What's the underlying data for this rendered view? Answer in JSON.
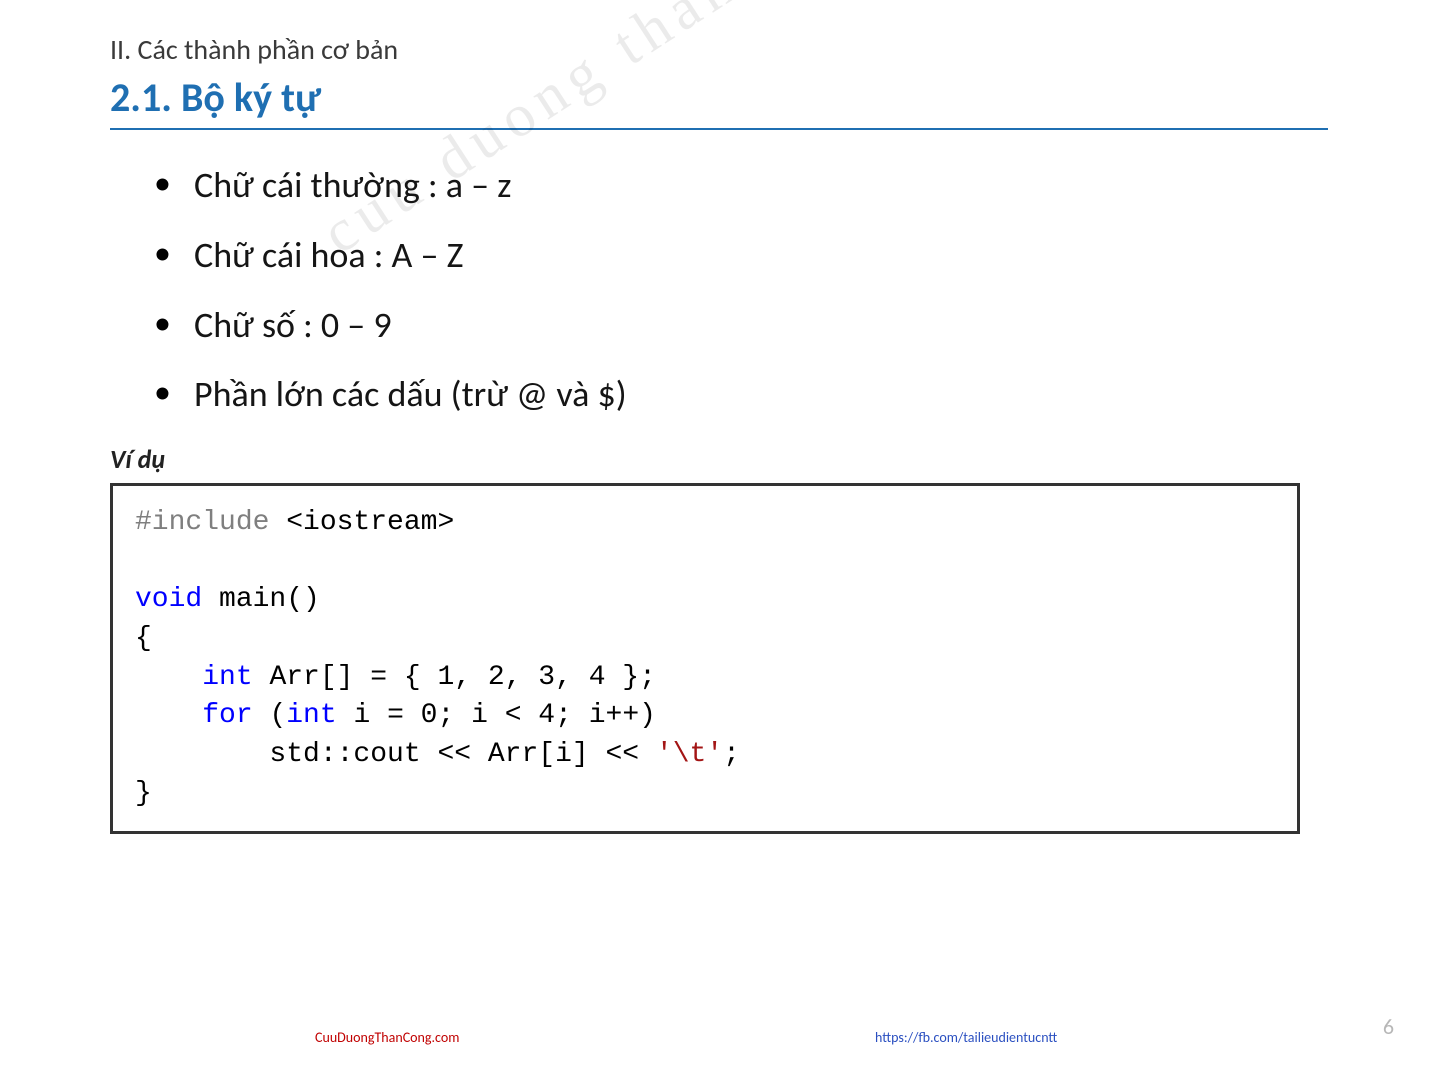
{
  "header": {
    "breadcrumb": "II. Các thành phần cơ bản",
    "section_title": "2.1. Bộ ký tự"
  },
  "bullets": [
    "Chữ cái thường : a – z",
    "Chữ cái hoa : A – Z",
    "Chữ số : 0 – 9",
    "Phần lớn các dấu (trừ @ và $)"
  ],
  "example_label": "Ví dụ",
  "code": {
    "line1_pp": "#include",
    "line1_rest": " <iostream>",
    "line2_kw": "void",
    "line2_rest": " main()",
    "line3": "{",
    "line4_indent": "    ",
    "line4_kw": "int",
    "line4_rest": " Arr[] = { 1, 2, 3, 4 };",
    "line5_indent": "    ",
    "line5_kw1": "for",
    "line5_mid": " (",
    "line5_kw2": "int",
    "line5_rest": " i = 0; i < 4; i++)",
    "line6_indent": "        ",
    "line6_a": "std::cout << Arr[i] << ",
    "line6_ch": "'\\t'",
    "line6_b": ";",
    "line7": "}"
  },
  "watermark": "cuu duong than cong . com",
  "footer": {
    "left": "CuuDuongThanCong.com",
    "right": "https://fb.com/tailieudientucntt"
  },
  "page_number": "6"
}
